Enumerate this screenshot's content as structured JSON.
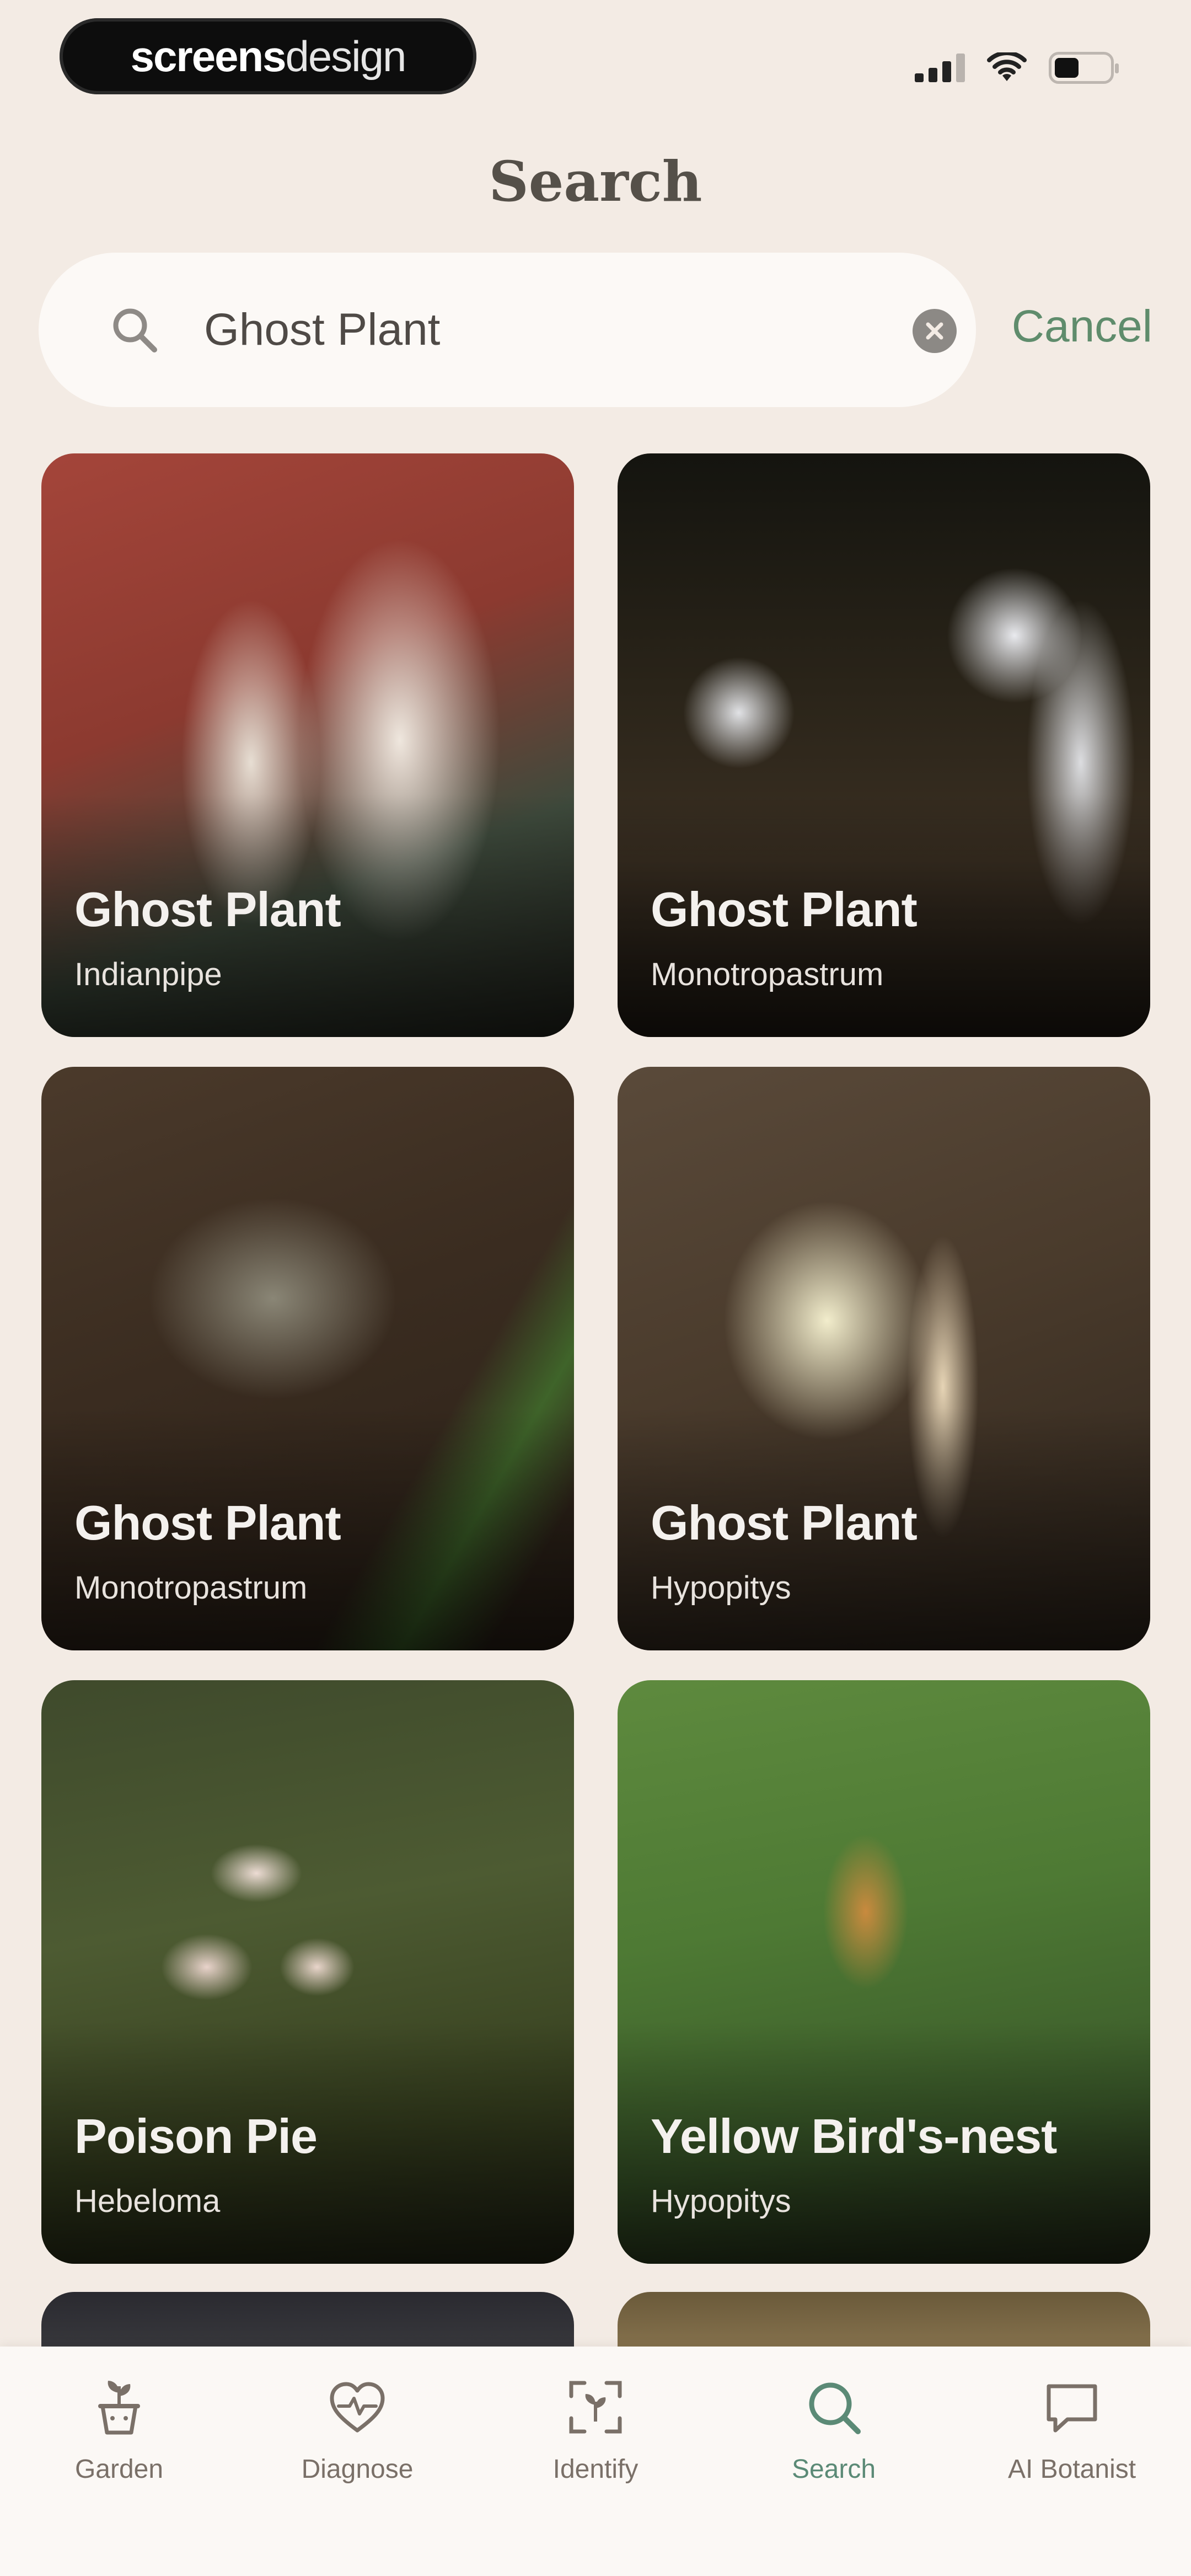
{
  "status_bar": {
    "brand_part1": "screens",
    "brand_part2": "design",
    "battery_level": 0.45
  },
  "header": {
    "title": "Search"
  },
  "search": {
    "query": "Ghost Plant",
    "cancel_label": "Cancel",
    "clear_icon": "clear-icon",
    "search_icon": "search-icon"
  },
  "results": [
    {
      "name": "Ghost Plant",
      "scientific": "Indianpipe"
    },
    {
      "name": "Ghost Plant",
      "scientific": "Monotropastrum"
    },
    {
      "name": "Ghost Plant",
      "scientific": "Monotropastrum"
    },
    {
      "name": "Ghost Plant",
      "scientific": "Hypopitys"
    },
    {
      "name": "Poison Pie",
      "scientific": "Hebeloma"
    },
    {
      "name": "Yellow Bird's-nest",
      "scientific": "Hypopitys"
    }
  ],
  "tabs": [
    {
      "label": "Garden",
      "icon": "plant-pot-icon",
      "active": false
    },
    {
      "label": "Diagnose",
      "icon": "heart-pulse-icon",
      "active": false
    },
    {
      "label": "Identify",
      "icon": "scan-icon",
      "active": false
    },
    {
      "label": "Search",
      "icon": "search-icon",
      "active": true
    },
    {
      "label": "AI Botanist",
      "icon": "chat-bubble-icon",
      "active": false
    }
  ],
  "colors": {
    "background": "#f3ebe4",
    "accent": "#5f8c6c",
    "tab_inactive": "#7a7068",
    "tab_active": "#5b8a76"
  }
}
